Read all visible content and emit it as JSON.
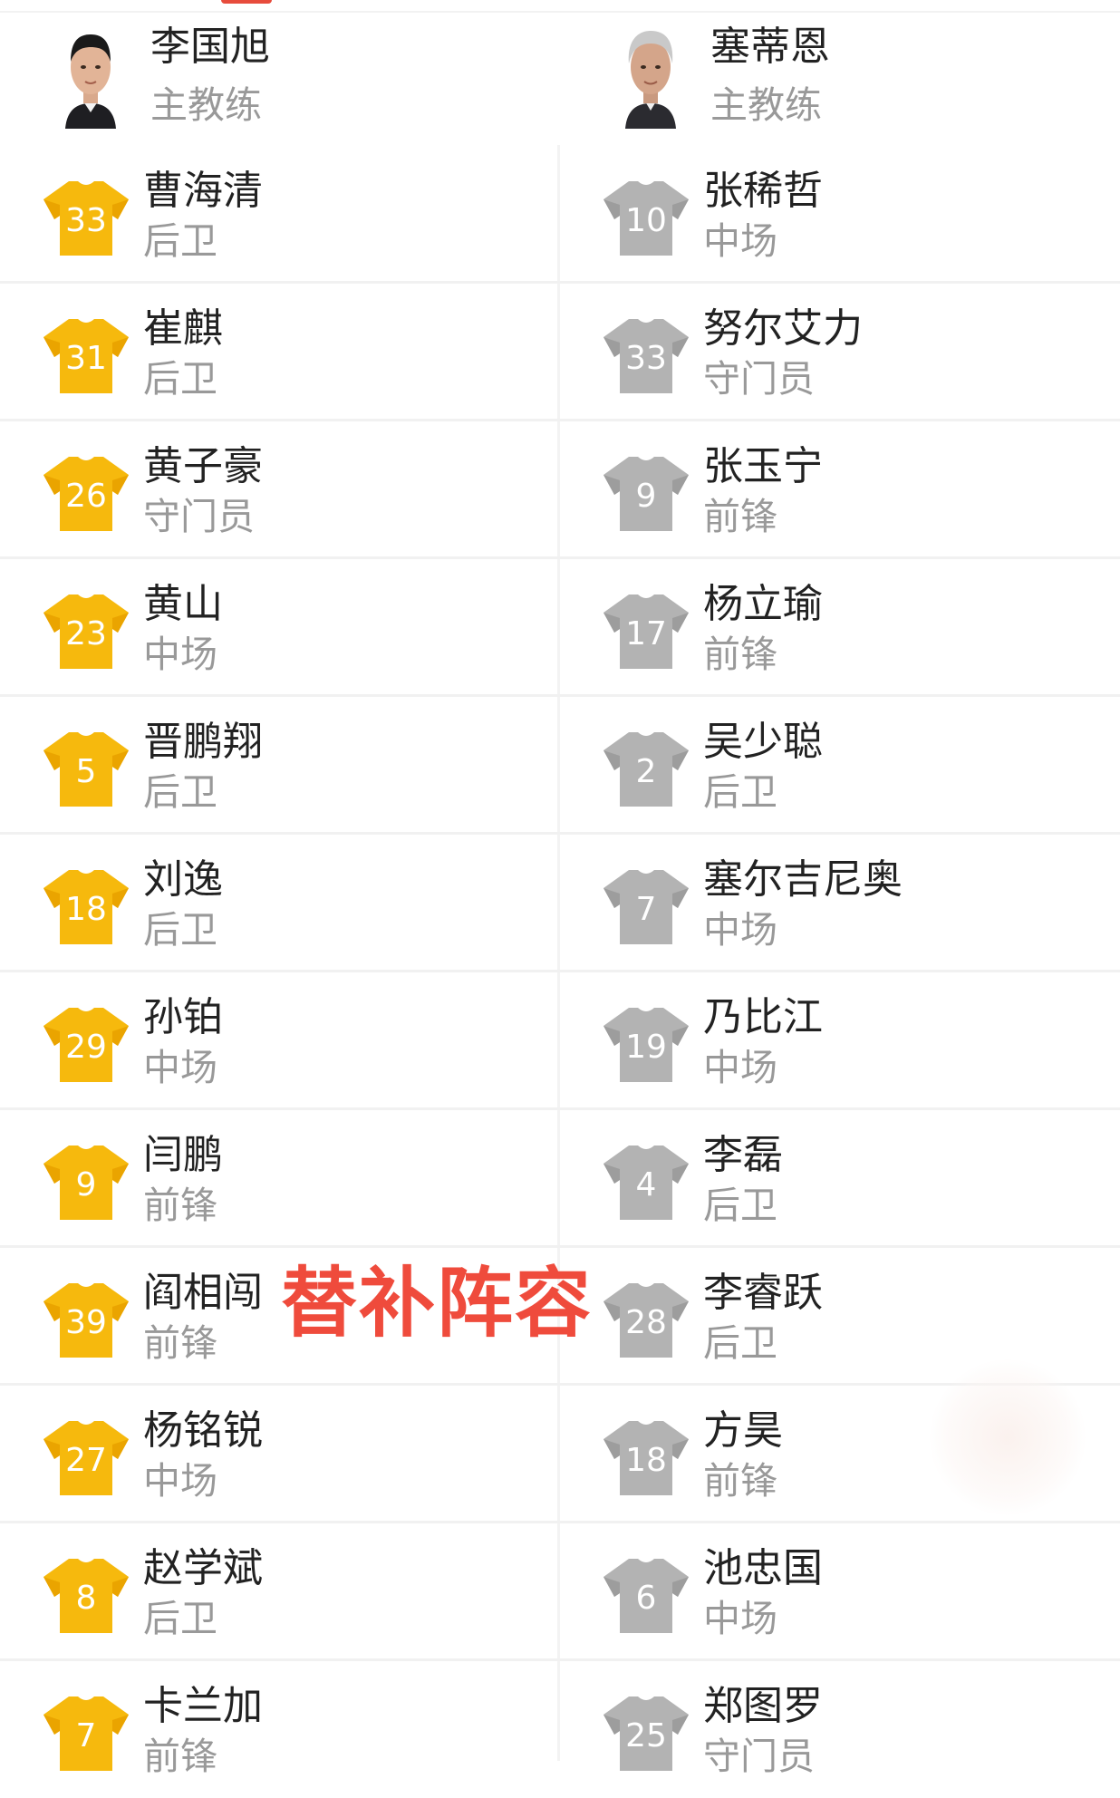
{
  "colors": {
    "home_jersey": "#f6b90d",
    "home_jersey_shade": "#eaa400",
    "away_jersey": "#b3b3b3",
    "away_jersey_shade": "#9d9d9d",
    "accent": "#ef4b3c",
    "name_text": "#222222",
    "role_text": "#999999"
  },
  "coaches": {
    "home": {
      "name": "李国旭",
      "role": "主教练",
      "icon": "coach-photo"
    },
    "away": {
      "name": "塞蒂恩",
      "role": "主教练",
      "icon": "coach-photo"
    }
  },
  "overlay_title": "替补阵容",
  "home_players": [
    {
      "number": "33",
      "name": "曹海清",
      "position": "后卫"
    },
    {
      "number": "31",
      "name": "崔麒",
      "position": "后卫"
    },
    {
      "number": "26",
      "name": "黄子豪",
      "position": "守门员"
    },
    {
      "number": "23",
      "name": "黄山",
      "position": "中场"
    },
    {
      "number": "5",
      "name": "晋鹏翔",
      "position": "后卫"
    },
    {
      "number": "18",
      "name": "刘逸",
      "position": "后卫"
    },
    {
      "number": "29",
      "name": "孙铂",
      "position": "中场"
    },
    {
      "number": "9",
      "name": "闫鹏",
      "position": "前锋"
    },
    {
      "number": "39",
      "name": "阎相闯",
      "position": "前锋"
    },
    {
      "number": "27",
      "name": "杨铭锐",
      "position": "中场"
    },
    {
      "number": "8",
      "name": "赵学斌",
      "position": "后卫"
    },
    {
      "number": "7",
      "name": "卡兰加",
      "position": "前锋"
    }
  ],
  "away_players": [
    {
      "number": "10",
      "name": "张稀哲",
      "position": "中场"
    },
    {
      "number": "33",
      "name": "努尔艾力",
      "position": "守门员"
    },
    {
      "number": "9",
      "name": "张玉宁",
      "position": "前锋"
    },
    {
      "number": "17",
      "name": "杨立瑜",
      "position": "前锋"
    },
    {
      "number": "2",
      "name": "吴少聪",
      "position": "后卫"
    },
    {
      "number": "7",
      "name": "塞尔吉尼奥",
      "position": "中场"
    },
    {
      "number": "19",
      "name": "乃比江",
      "position": "中场"
    },
    {
      "number": "4",
      "name": "李磊",
      "position": "后卫"
    },
    {
      "number": "28",
      "name": "李睿跃",
      "position": "后卫"
    },
    {
      "number": "18",
      "name": "方昊",
      "position": "前锋"
    },
    {
      "number": "6",
      "name": "池忠国",
      "position": "中场"
    },
    {
      "number": "25",
      "name": "郑图罗",
      "position": "守门员"
    }
  ]
}
